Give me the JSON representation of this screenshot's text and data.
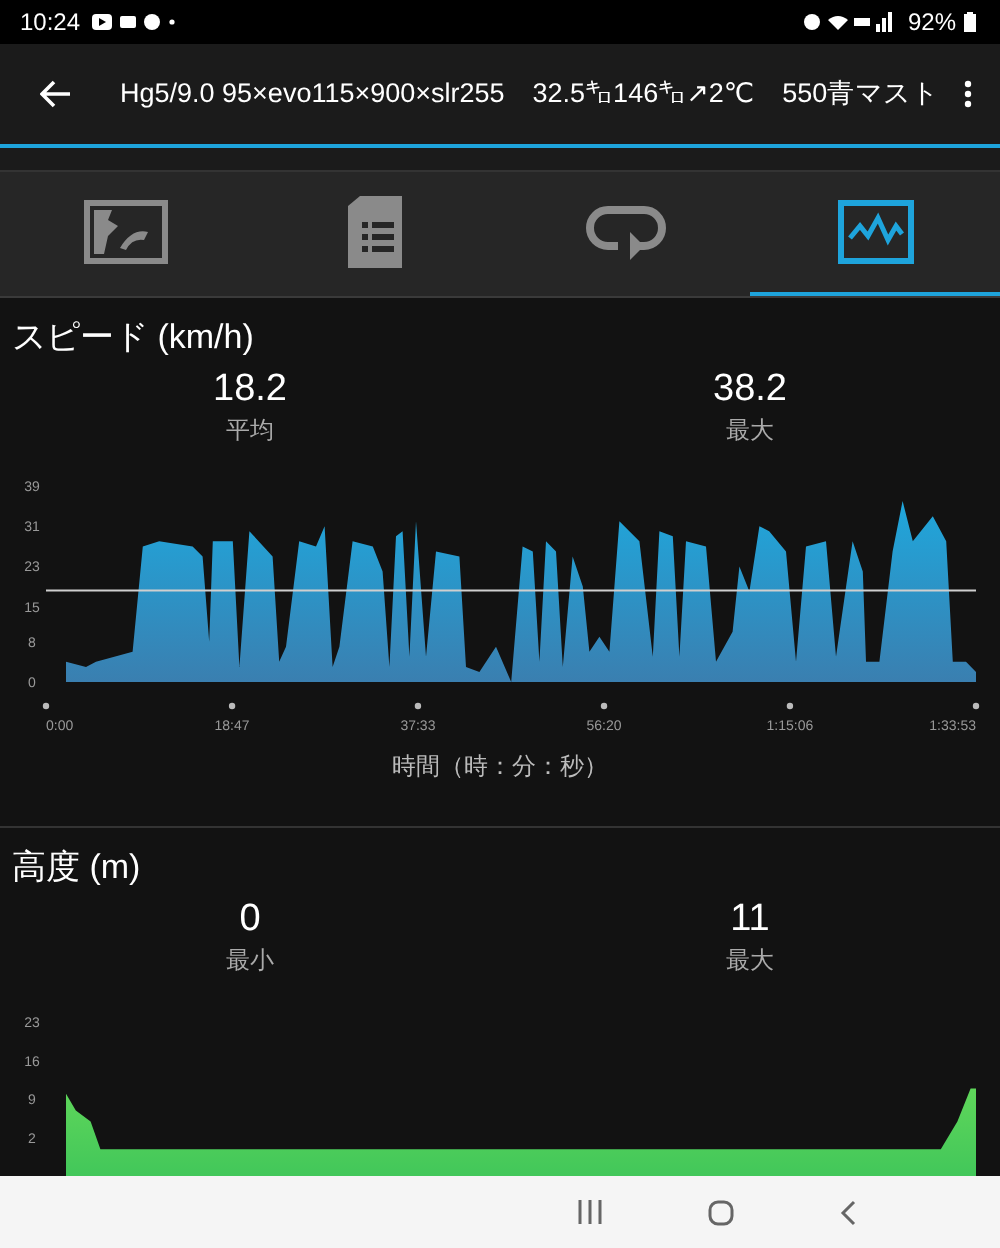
{
  "status_bar": {
    "time": "10:24",
    "battery": "92%"
  },
  "app_bar": {
    "title": "Hg5/9.0 95×evo115×900×slr255　32.5㌔146㌔↗2℃　550青マスト"
  },
  "tabs": [
    {
      "kind": "map",
      "selected": false
    },
    {
      "kind": "document",
      "selected": false
    },
    {
      "kind": "loop",
      "selected": false
    },
    {
      "kind": "graph",
      "selected": true
    }
  ],
  "sections": [
    {
      "title": "スピード (km/h)",
      "stats": [
        {
          "value": "18.2",
          "label": "平均"
        },
        {
          "value": "38.2",
          "label": "最大"
        }
      ],
      "axis_title": "時間（時：分：秒）",
      "chart_data": {
        "type": "area",
        "color": "#1fa7dc",
        "x": [
          121,
          242,
          303,
          525,
          586,
          686,
          888,
          949,
          989,
          1010,
          1131,
          1171,
          1232,
          1373,
          1413,
          1454,
          1534,
          1635,
          1688,
          1736,
          1777,
          1857,
          1979,
          2039,
          2080,
          2120,
          2160,
          2201,
          2241,
          2302,
          2362,
          2504,
          2544,
          2625,
          2726,
          2818,
          2887,
          2948,
          2988,
          3029,
          3089,
          3130,
          3190,
          3251,
          3291,
          3352,
          3412,
          3473,
          3594,
          3675,
          3715,
          3796,
          3836,
          3876,
          3998,
          4058,
          4159,
          4200,
          4260,
          4321,
          4381,
          4482,
          4543,
          4603,
          4725,
          4785,
          4886,
          4947,
          4967,
          5048,
          5128,
          5189,
          5250,
          5371,
          5452,
          5492,
          5573,
          5633
        ],
        "values": [
          4,
          3,
          4,
          6,
          27,
          28,
          27,
          25,
          8,
          28,
          28,
          3,
          30,
          25,
          4,
          7,
          28,
          27,
          31,
          3,
          7,
          28,
          27,
          22,
          3,
          29,
          30,
          5,
          32,
          5,
          26,
          25,
          3,
          2,
          7,
          0,
          27,
          26,
          4,
          28,
          26,
          3,
          25,
          19,
          6,
          9,
          6,
          32,
          28,
          5,
          30,
          29,
          5,
          28,
          27,
          4,
          10,
          23,
          18,
          31,
          30,
          26,
          4,
          27,
          28,
          5,
          28,
          22,
          4,
          4,
          26,
          36,
          28,
          33,
          28,
          4,
          4,
          2
        ],
        "xlim": [
          0,
          5633
        ],
        "ylim": [
          0,
          39
        ],
        "xticks": [
          {
            "value": 0,
            "label": "0:00"
          },
          {
            "value": 1127,
            "label": "18:47"
          },
          {
            "value": 2253,
            "label": "37:33"
          },
          {
            "value": 3380,
            "label": "56:20"
          },
          {
            "value": 4506,
            "label": "1:15:06"
          },
          {
            "value": 5633,
            "label": "1:33:53"
          }
        ],
        "yticks": [
          0,
          8,
          15,
          23,
          31,
          39
        ],
        "ref_lines": [
          {
            "axis": "y",
            "value": 18.2
          }
        ]
      }
    },
    {
      "title": "高度 (m)",
      "stats": [
        {
          "value": "0",
          "label": "最小"
        },
        {
          "value": "11",
          "label": "最大"
        }
      ],
      "chart_data": {
        "type": "area",
        "color": "#3cc45a",
        "x": [
          121,
          180,
          270,
          330,
          5420,
          5520,
          5600,
          5633
        ],
        "values": [
          10,
          7,
          5,
          0,
          0,
          5,
          11,
          11
        ],
        "xlim": [
          0,
          5633
        ],
        "ylim": [
          0,
          23
        ],
        "yticks": [
          2,
          9,
          16,
          23
        ]
      }
    }
  ]
}
